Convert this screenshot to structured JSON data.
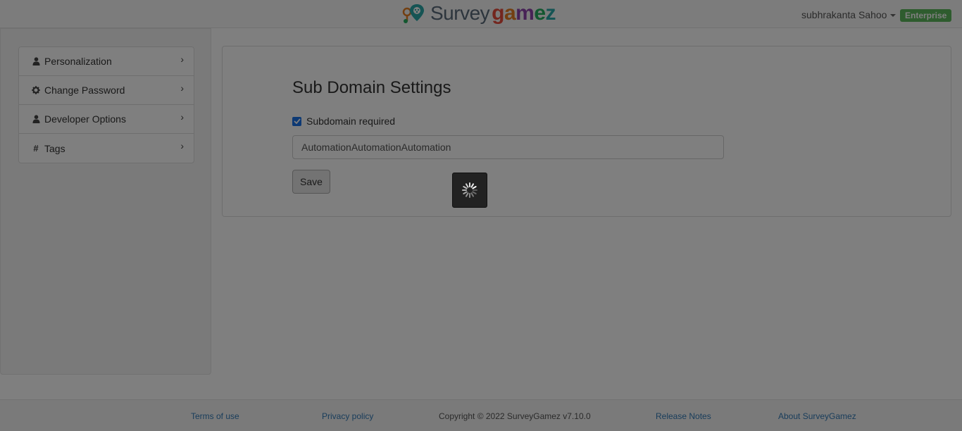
{
  "header": {
    "logo_text_part1": "Survey",
    "logo_text_part2": "gamez",
    "user_name": "subhrakanta Sahoo",
    "plan_badge": "Enterprise"
  },
  "sidebar": {
    "items": [
      {
        "label": "Personalization",
        "icon": "user-icon"
      },
      {
        "label": "Change Password",
        "icon": "gear-icon"
      },
      {
        "label": "Developer Options",
        "icon": "user-icon"
      },
      {
        "label": "Tags",
        "icon": "hash-icon"
      }
    ]
  },
  "main": {
    "title": "Sub Domain Settings",
    "checkbox_label": "Subdomain required",
    "checkbox_checked": true,
    "subdomain_value": "AutomationAutomationAutomation",
    "save_label": "Save"
  },
  "footer": {
    "terms": "Terms of use",
    "privacy": "Privacy policy",
    "copyright": "Copyright © 2022 SurveyGamez v7.10.0",
    "release_notes": "Release Notes",
    "about": "About SurveyGamez"
  },
  "colors": {
    "accent": "#1a73e8",
    "badge": "#5cb85c",
    "link": "#337ab7",
    "logo_grey": "#5b6b7a"
  },
  "loading": true
}
